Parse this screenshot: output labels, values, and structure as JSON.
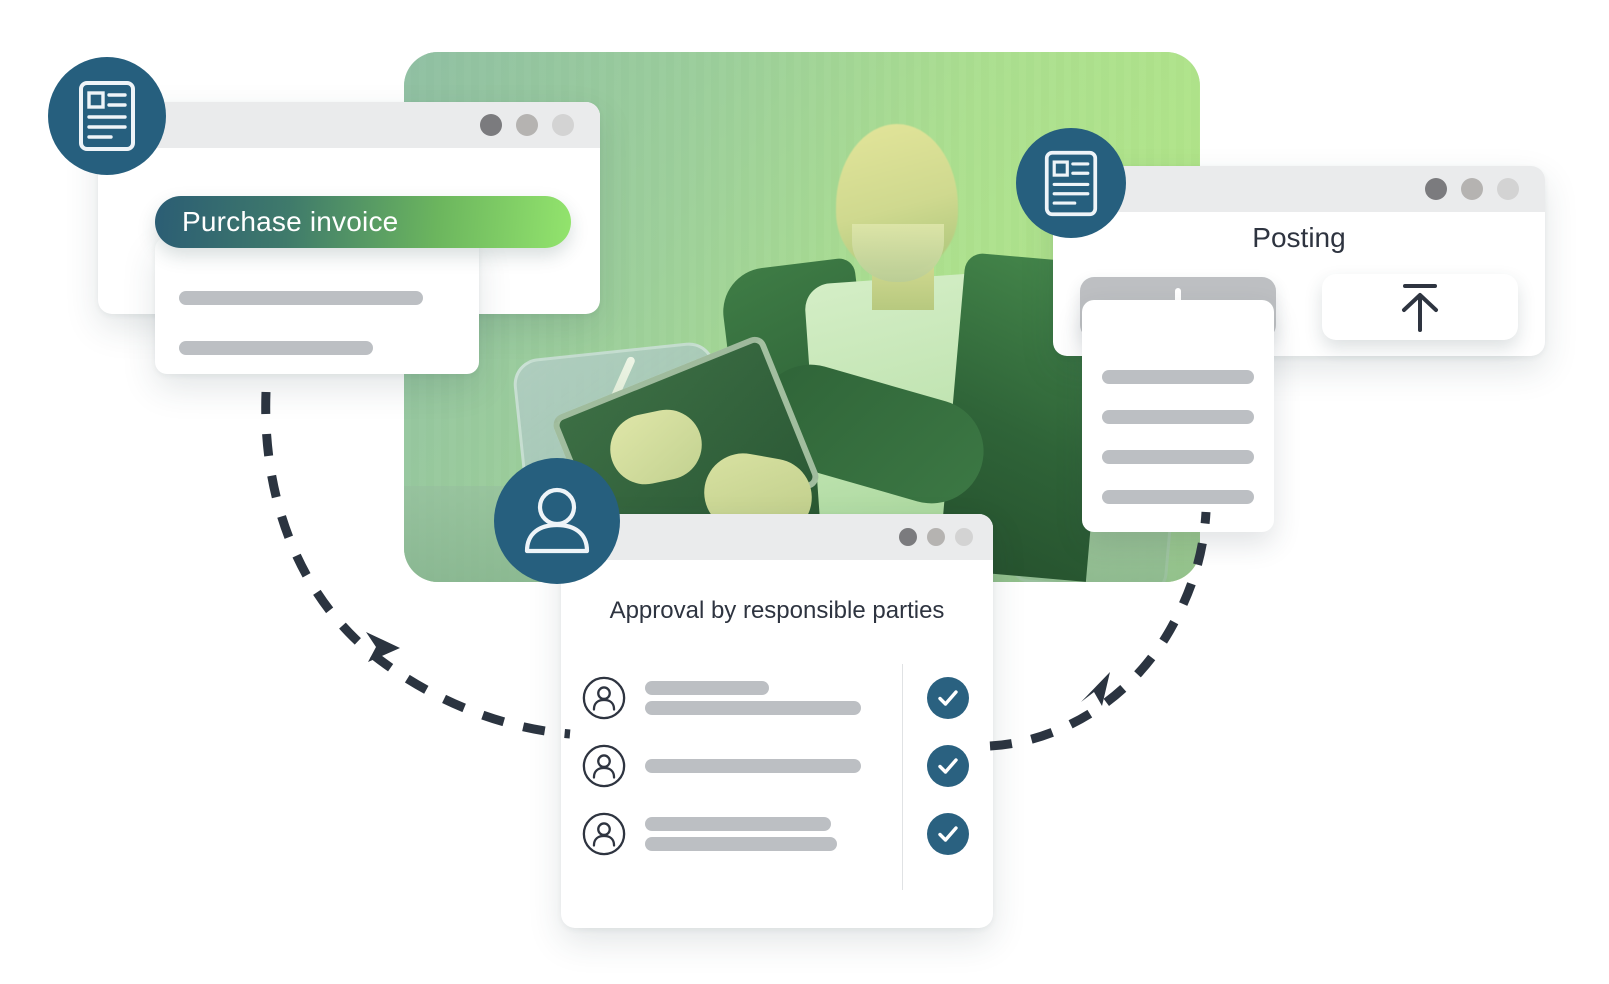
{
  "scene": {
    "title": "Purchase invoice approval workflow illustration",
    "accent_teal": "#265f7e",
    "accent_green": "#93e46d",
    "gradient_start": "#2b5d74",
    "gradient_end": "#93e46d",
    "placeholder_gray": "#bcbfc3",
    "check_color": "#2a6180"
  },
  "hero": {
    "alt": "Smiling businessman seated in a chair using a tablet with a stylus, green duotone overlay"
  },
  "invoice_window": {
    "dots": [
      "dark",
      "medium",
      "light"
    ],
    "pill_label": "Purchase invoice",
    "placeholder_rows": 2
  },
  "posting_window": {
    "dots": [
      "dark",
      "medium",
      "light"
    ],
    "title": "Posting",
    "add_button_icon": "plus-icon",
    "upload_button_icon": "upload-arrow-icon",
    "list_rows": 4
  },
  "approval_window": {
    "dots": [
      "dark",
      "medium",
      "light"
    ],
    "title": "Approval by responsible parties",
    "rows": [
      {
        "avatar_icon": "person-circle-icon",
        "lines": [
          248,
          330
        ],
        "status_icon": "check-circle-icon"
      },
      {
        "avatar_icon": "person-circle-icon",
        "lines": [
          330
        ],
        "status_icon": "check-circle-icon"
      },
      {
        "avatar_icon": "person-circle-icon",
        "lines": [
          290,
          300
        ],
        "status_icon": "check-circle-icon"
      }
    ]
  },
  "badges": [
    {
      "name": "document-badge-left",
      "icon": "document-icon"
    },
    {
      "name": "document-badge-right",
      "icon": "document-icon"
    },
    {
      "name": "user-badge",
      "icon": "user-icon"
    }
  ],
  "arrows": [
    {
      "name": "arrow-invoice-to-approval",
      "direction": "down-right",
      "style": "dashed"
    },
    {
      "name": "arrow-approval-to-posting",
      "direction": "up-right",
      "style": "dashed"
    }
  ]
}
